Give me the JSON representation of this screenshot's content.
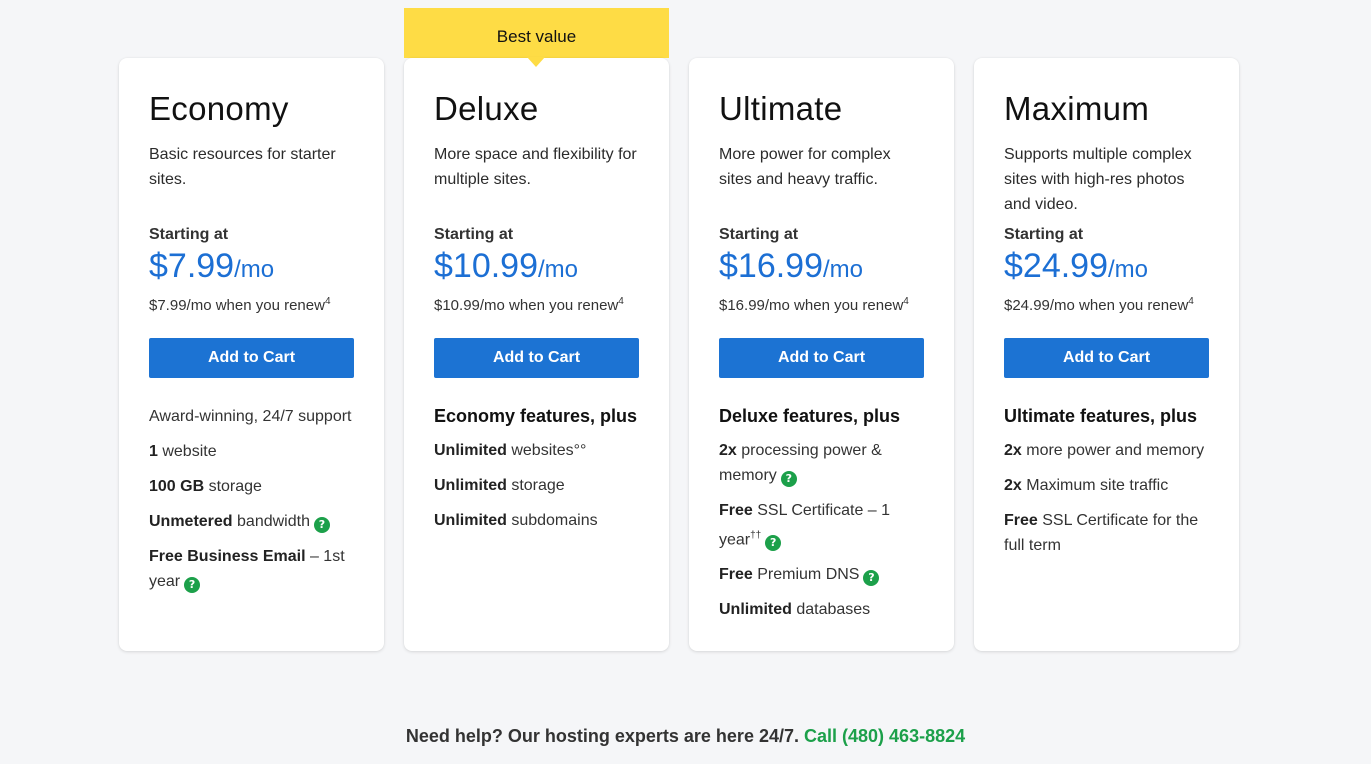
{
  "badge": {
    "label": "Best value"
  },
  "plans": [
    {
      "name": "Economy",
      "desc": "Basic resources for starter sites.",
      "starting": "Starting at",
      "price": "$7.99",
      "per": "/mo",
      "renew": "$7.99/mo when you renew",
      "renew_note": "4",
      "cta": "Add to Cart",
      "features": [
        {
          "pre": "",
          "bold": "",
          "text": "Award-winning, 24/7 support"
        },
        {
          "bold": "1",
          "text": " website"
        },
        {
          "bold": "100 GB",
          "text": " storage"
        },
        {
          "bold": "Unmetered",
          "text": " bandwidth"
        },
        {
          "bold": "Free Business Email",
          "text": " – 1st year"
        }
      ]
    },
    {
      "name": "Deluxe",
      "desc": "More space and flexibility for multiple sites.",
      "starting": "Starting at",
      "price": "$10.99",
      "per": "/mo",
      "renew": "$10.99/mo when you renew",
      "renew_note": "4",
      "cta": "Add to Cart",
      "features_head": "Economy features, plus",
      "features": [
        {
          "bold": "Unlimited",
          "text": " websites°°"
        },
        {
          "bold": "Unlimited",
          "text": " storage"
        },
        {
          "bold": "Unlimited",
          "text": " subdomains"
        }
      ]
    },
    {
      "name": "Ultimate",
      "desc": "More power for complex sites and heavy traffic.",
      "starting": "Starting at",
      "price": "$16.99",
      "per": "/mo",
      "renew": "$16.99/mo when you renew",
      "renew_note": "4",
      "cta": "Add to Cart",
      "features_head": "Deluxe features, plus",
      "features": [
        {
          "bold": "2x",
          "text": " processing power & memory"
        },
        {
          "bold": "Free",
          "text": " SSL Certificate – 1 year",
          "note": "††"
        },
        {
          "bold": "Free",
          "text": " Premium DNS"
        },
        {
          "bold": "Unlimited",
          "text": " databases"
        }
      ]
    },
    {
      "name": "Maximum",
      "desc": "Supports multiple complex sites with high-res photos and video.",
      "starting": "Starting at",
      "price": "$24.99",
      "per": "/mo",
      "renew": "$24.99/mo when you renew",
      "renew_note": "4",
      "cta": "Add to Cart",
      "features_head": "Ultimate features, plus",
      "features": [
        {
          "bold": "2x",
          "text": " more power and memory"
        },
        {
          "bold": "2x",
          "text": " Maximum site traffic"
        },
        {
          "bold": "Free",
          "text": " SSL Certificate for the full term"
        }
      ]
    }
  ],
  "help_icon": {
    "glyph": "?",
    "color": "#1ca04a"
  },
  "footer": {
    "text": "Need help? Our hosting experts are here 24/7.",
    "phone": "Call (480) 463-8824"
  },
  "colors": {
    "accent": "#1c73d3",
    "price": "#1c6fd4",
    "badge": "#fedc45",
    "phone": "#1ca04a"
  }
}
